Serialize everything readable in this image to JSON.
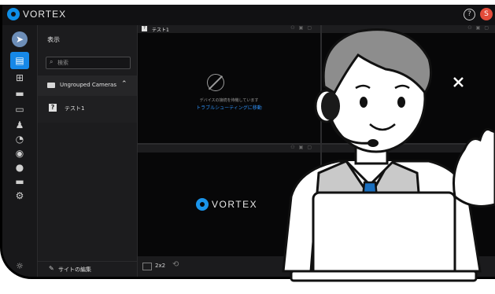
{
  "app": {
    "brand": "VORTEX",
    "help_icon": "question-circle-icon",
    "avatar_initial": "S"
  },
  "sidebar": {
    "title": "表示",
    "search_placeholder": "検索",
    "group_label": "Ungrouped Cameras",
    "camera_label": "テスト1",
    "edit_site_label": "サイトの編集"
  },
  "tiles": {
    "main_title": "テスト1",
    "offline_msg": "デバイスの接続を待機しています",
    "troubleshoot_link": "トラブルシューティングに移動",
    "logo_text": "VORTEX"
  },
  "bottombar": {
    "layout_label": "2x2"
  },
  "colors": {
    "accent": "#1688e8",
    "background": "#1d1d1f",
    "link": "#2d8df0"
  }
}
